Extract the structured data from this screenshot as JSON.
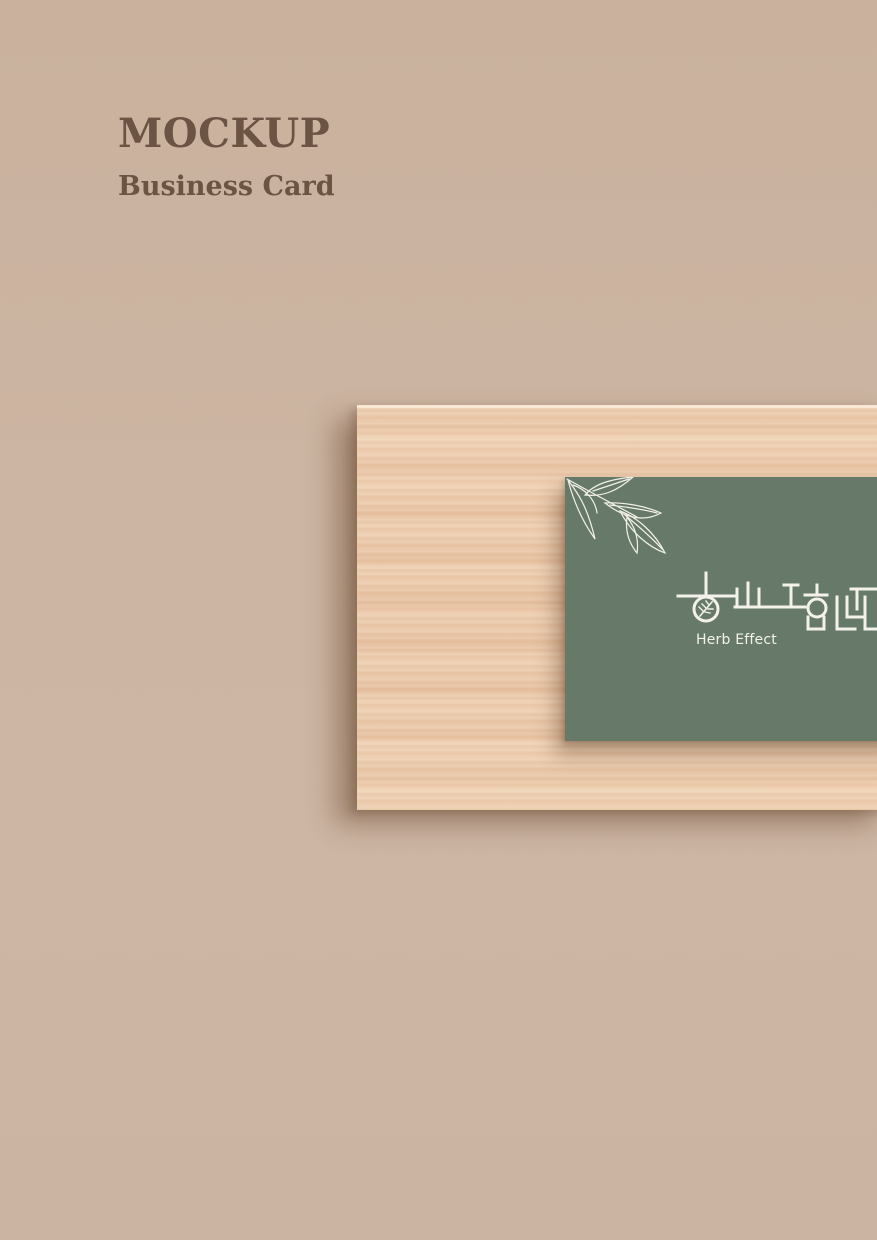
{
  "heading": {
    "title": "MOCKUP",
    "subtitle": "Business Card"
  },
  "card": {
    "brand_text": "Herb Effect",
    "color": "#677a69",
    "ink_color": "#f3f1ea"
  },
  "board": {
    "material": "bamboo-wood"
  },
  "background_color": "#cbb4a1"
}
